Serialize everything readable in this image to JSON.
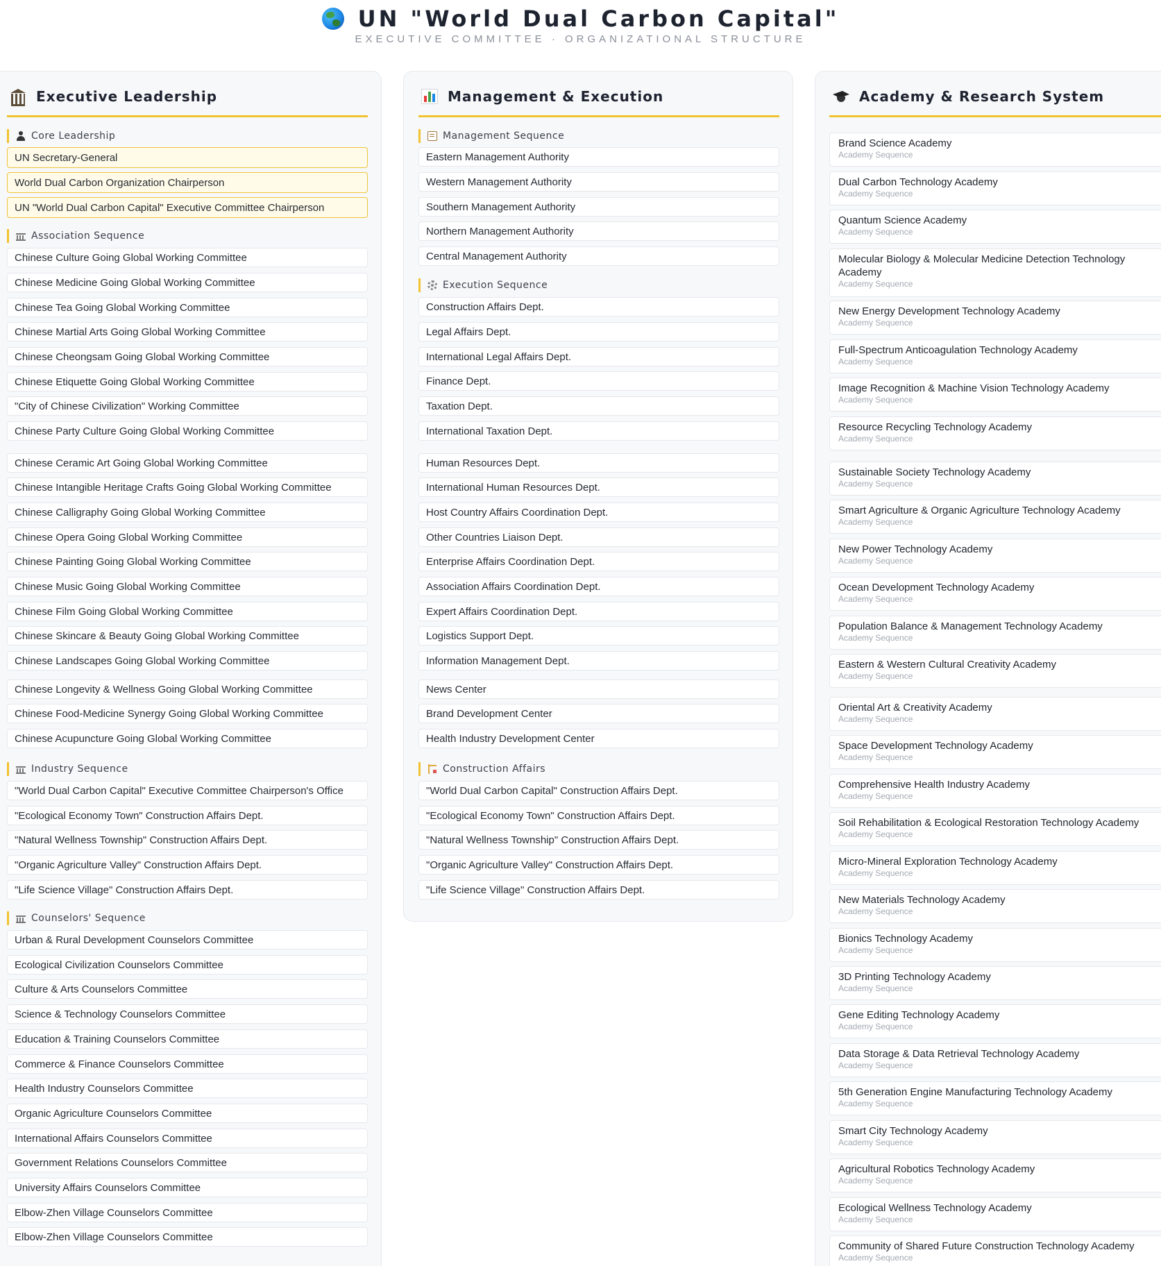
{
  "header": {
    "title": "UN \"World Dual Carbon Capital\"",
    "subtitle": "EXECUTIVE COMMITTEE · ORGANIZATIONAL STRUCTURE"
  },
  "colors": {
    "accent": "#f2c230",
    "panel_bg": "#f7f8fa",
    "core_bg": "#fffbe8"
  },
  "icons": {
    "header": "globe-icon",
    "executive": "bank-icon",
    "management": "bar-chart-icon",
    "academy": "graduation-cap-icon"
  },
  "executive": {
    "title": "Executive Leadership",
    "core": {
      "label": "Core Leadership",
      "items": [
        "UN Secretary-General",
        "World Dual Carbon Organization Chairperson",
        "UN \"World Dual Carbon Capital\" Executive Committee Chairperson"
      ]
    },
    "association": {
      "label": "Association Sequence",
      "items": [
        "Chinese Culture Going Global Working Committee",
        "Chinese Medicine Going Global Working Committee",
        "Chinese Tea Going Global Working Committee",
        "Chinese Martial Arts Going Global Working Committee",
        "Chinese Cheongsam Going Global Working Committee",
        "Chinese Etiquette Going Global Working Committee",
        "\"City of Chinese Civilization\" Working Committee",
        "Chinese Party Culture Going Global Working Committee",
        "Chinese Ceramic Art Going Global Working Committee",
        "Chinese Intangible Heritage Crafts Going Global Working Committee",
        "Chinese Calligraphy Going Global Working Committee",
        "Chinese Opera Going Global Working Committee",
        "Chinese Painting Going Global Working Committee",
        "Chinese Music Going Global Working Committee",
        "Chinese Film Going Global Working Committee",
        "Chinese Skincare & Beauty Going Global Working Committee",
        "Chinese Landscapes Going Global Working Committee",
        "Chinese Longevity & Wellness Going Global Working Committee",
        "Chinese Food-Medicine Synergy Going Global Working Committee",
        "Chinese Acupuncture Going Global Working Committee"
      ]
    },
    "industry": {
      "label": "Industry Sequence",
      "items": [
        "\"World Dual Carbon Capital\" Executive Committee Chairperson's Office",
        "\"Ecological Economy Town\" Construction Affairs Dept.",
        "\"Natural Wellness Township\" Construction Affairs Dept.",
        "\"Organic Agriculture Valley\" Construction Affairs Dept.",
        "\"Life Science Village\" Construction Affairs Dept."
      ]
    },
    "counselors": {
      "label": "Counselors' Sequence",
      "items": [
        "Urban & Rural Development Counselors Committee",
        "Ecological Civilization Counselors Committee",
        "Culture & Arts Counselors Committee",
        "Science & Technology Counselors Committee",
        "Education & Training Counselors Committee",
        "Commerce & Finance Counselors Committee",
        "Health Industry Counselors Committee",
        "Organic Agriculture Counselors Committee",
        "International Affairs Counselors Committee",
        "Government Relations Counselors Committee",
        "University Affairs Counselors Committee",
        "Elbow-Zhen Village Counselors Committee",
        "Elbow-Zhen Village Counselors Committee"
      ]
    }
  },
  "management": {
    "title": "Management & Execution",
    "mgmt_seq": {
      "label": "Management Sequence",
      "items": [
        "Eastern Management Authority",
        "Western Management Authority",
        "Southern Management Authority",
        "Northern Management Authority",
        "Central Management Authority"
      ]
    },
    "exec_seq": {
      "label": "Execution Sequence",
      "items": [
        "Construction Affairs Dept.",
        "Legal Affairs Dept.",
        "International Legal Affairs Dept.",
        "Finance Dept.",
        "Taxation Dept.",
        "International Taxation Dept.",
        "Human Resources Dept.",
        "International Human Resources Dept.",
        "Host Country Affairs Coordination Dept.",
        "Other Countries Liaison Dept.",
        "Enterprise Affairs Coordination Dept.",
        "Association Affairs Coordination Dept.",
        "Expert Affairs Coordination Dept.",
        "Logistics Support Dept.",
        "Information Management Dept.",
        "News Center",
        "Brand Development Center",
        "Health Industry Development Center"
      ]
    },
    "construction": {
      "label": "Construction Affairs",
      "items": [
        "\"World Dual Carbon Capital\" Construction Affairs Dept.",
        "\"Ecological Economy Town\" Construction Affairs Dept.",
        "\"Natural Wellness Township\" Construction Affairs Dept.",
        "\"Organic Agriculture Valley\" Construction Affairs Dept.",
        "\"Life Science Village\" Construction Affairs Dept."
      ]
    }
  },
  "academy": {
    "title": "Academy & Research System",
    "sequence_label": "Academy Sequence",
    "items": [
      "Brand Science Academy",
      "Dual Carbon Technology Academy",
      "Quantum Science Academy",
      "Molecular Biology & Molecular Medicine Detection Technology Academy",
      "New Energy Development Technology Academy",
      "Full-Spectrum Anticoagulation Technology Academy",
      "Image Recognition & Machine Vision Technology Academy",
      "Resource Recycling Technology Academy",
      "Sustainable Society Technology Academy",
      "Smart Agriculture & Organic Agriculture Technology Academy",
      "New Power Technology Academy",
      "Ocean Development Technology Academy",
      "Population Balance & Management Technology Academy",
      "Eastern & Western Cultural Creativity Academy",
      "Oriental Art & Creativity Academy",
      "Space Development Technology Academy",
      "Comprehensive Health Industry Academy",
      "Soil Rehabilitation & Ecological Restoration Technology Academy",
      "Micro-Mineral Exploration Technology Academy",
      "New Materials Technology Academy",
      "Bionics Technology Academy",
      "3D Printing Technology Academy",
      "Gene Editing Technology Academy",
      "Data Storage & Data Retrieval Technology Academy",
      "5th Generation Engine Manufacturing Technology Academy",
      "Smart City Technology Academy",
      "Agricultural Robotics Technology Academy",
      "Ecological Wellness Technology Academy",
      "Community of Shared Future Construction Technology Academy"
    ]
  }
}
